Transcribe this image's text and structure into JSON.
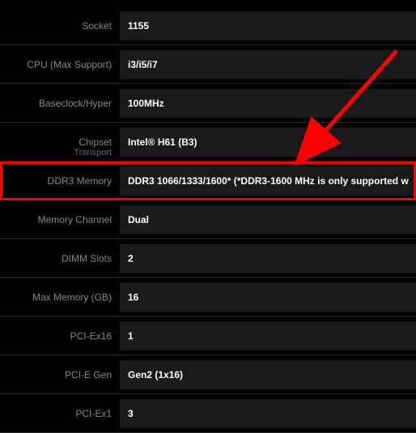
{
  "specs": [
    {
      "label": "Socket",
      "value": "1155"
    },
    {
      "label": "CPU (Max Support)",
      "value": "i3/i5/i7"
    },
    {
      "label": "Baseclock/Hyper",
      "value": "100MHz"
    },
    {
      "label": "Chipset",
      "value": "Intel® H61 (B3)",
      "secondaryLabel": "Transport"
    },
    {
      "label": "DDR3 Memory",
      "value": "DDR3 1066/1333/1600* (*DDR3-1600 MHz is only supported w",
      "highlighted": true
    },
    {
      "label": "Memory Channel",
      "value": "Dual"
    },
    {
      "label": "DIMM Slots",
      "value": "2"
    },
    {
      "label": "Max Memory (GB)",
      "value": "16"
    },
    {
      "label": "PCI-Ex16",
      "value": "1"
    },
    {
      "label": "PCI-E Gen",
      "value": "Gen2 (1x16)"
    },
    {
      "label": "PCI-Ex1",
      "value": "3"
    }
  ],
  "annotation": {
    "arrowColor": "#ff0000"
  }
}
